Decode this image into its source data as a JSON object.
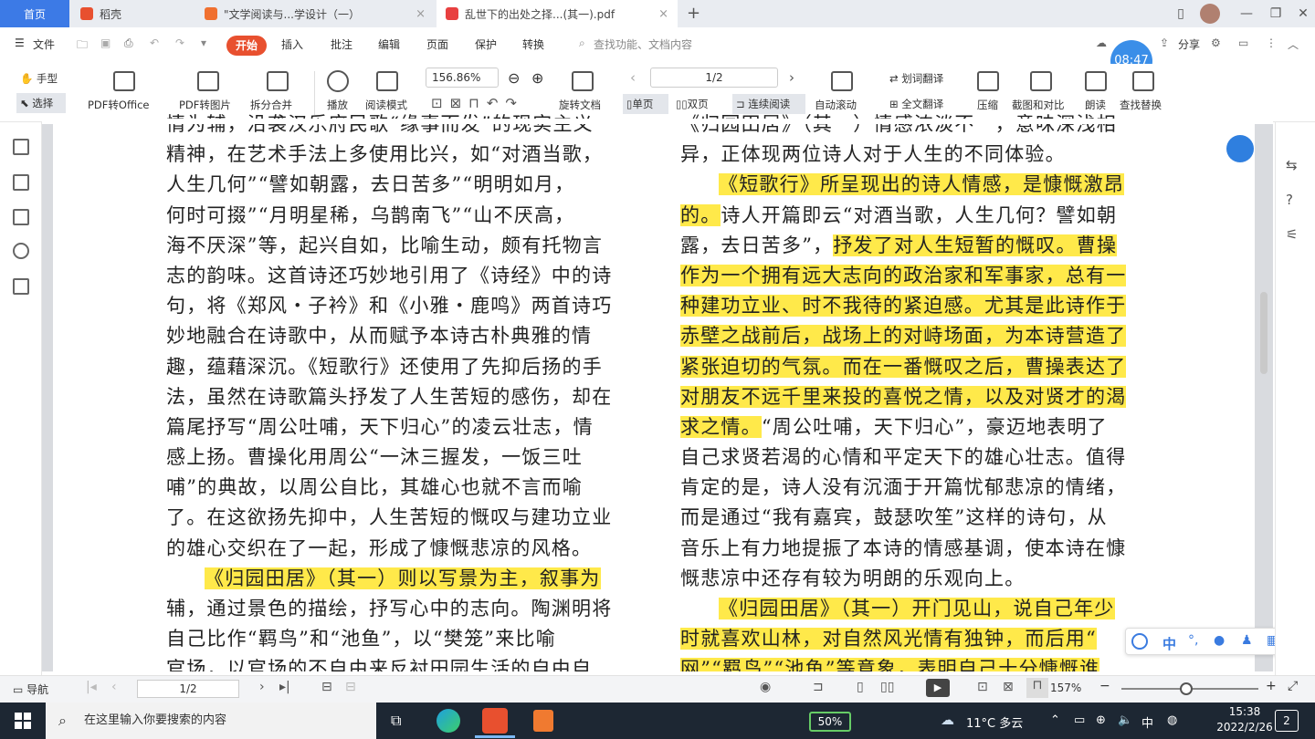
{
  "tabs": {
    "home": "首页",
    "t1": "稻壳",
    "t2": "\"文学阅读与...学设计（一）",
    "t3": "乱世下的出处之择...(其一).pdf",
    "add": "+"
  },
  "menu": {
    "file": "文件",
    "start": "开始",
    "insert": "插入",
    "annotate": "批注",
    "edit": "编辑",
    "page": "页面",
    "protect": "保护",
    "convert": "转换",
    "search_placeholder": "查找功能、文档内容",
    "share": "分享"
  },
  "toolbar": {
    "hand": "手型",
    "select": "选择",
    "pdf_to_office": "PDF转Office",
    "pdf_to_image": "PDF转图片",
    "split_merge": "拆分合并",
    "play": "播放",
    "reading_mode": "阅读模式",
    "zoom": "156.86%",
    "rotate_doc": "旋转文档",
    "page": "1/2",
    "single": "单页",
    "double": "双页",
    "continuous": "连续阅读",
    "auto_scroll": "自动滚动",
    "translate": "划词翻译",
    "full_translate": "全文翻译",
    "compress": "压缩",
    "screenshot_compare": "截图和对比",
    "read_aloud": "朗读",
    "find_replace": "查找替换"
  },
  "clock": "08:47",
  "doc": {
    "left_lines": [
      {
        "t": "情为辅，沿袭汉乐府民歌“缘事而发”的现实主义",
        "hl": false,
        "indent": false
      },
      {
        "t": "精神，在艺术手法上多使用比兴，如“对酒当歌，",
        "hl": false,
        "indent": false
      },
      {
        "t": "人生几何”“譬如朝露，去日苦多”“明明如月，",
        "hl": false,
        "indent": false
      },
      {
        "t": "何时可掇”“月明星稀，乌鹊南飞”“山不厌高，",
        "hl": false,
        "indent": false
      },
      {
        "t": "海不厌深”等，起兴自如，比喻生动，颇有托物言",
        "hl": false,
        "indent": false
      },
      {
        "t": "志的韵味。这首诗还巧妙地引用了《诗经》中的诗",
        "hl": false,
        "indent": false
      },
      {
        "t": "句，将《郑风・子衿》和《小雅・鹿鸣》两首诗巧",
        "hl": false,
        "indent": false
      },
      {
        "t": "妙地融合在诗歌中，从而赋予本诗古朴典雅的情",
        "hl": false,
        "indent": false
      },
      {
        "t": "趣，蕴藉深沉。《短歌行》还使用了先抑后扬的手",
        "hl": false,
        "indent": false
      },
      {
        "t": "法，虽然在诗歌篇头抒发了人生苦短的感伤，却在",
        "hl": false,
        "indent": false
      },
      {
        "t": "篇尾抒写“周公吐哺，天下归心”的凌云壮志，情",
        "hl": false,
        "indent": false
      },
      {
        "t": "感上扬。曹操化用周公“一沐三握发，一饭三吐",
        "hl": false,
        "indent": false
      },
      {
        "t": "哺”的典故，以周公自比，其雄心也就不言而喻",
        "hl": false,
        "indent": false
      },
      {
        "t": "了。在这欲扬先抑中，人生苦短的慨叹与建功立业",
        "hl": false,
        "indent": false
      },
      {
        "t": "的雄心交织在了一起，形成了慷慨悲凉的风格。",
        "hl": false,
        "indent": false
      },
      {
        "t": "《归园田居》（其一）则以写景为主，叙事为",
        "hl": true,
        "indent": true
      },
      {
        "t": "辅，通过景色的描绘，抒写心中的志向。陶渊明将",
        "hl": false,
        "indent": false
      },
      {
        "t": "自己比作“羁鸟”和“池鱼”，以“樊笼”来比喻",
        "hl": false,
        "indent": false
      },
      {
        "t": "官场，以官场的不自由来反衬田园生活的自由自",
        "hl": false,
        "indent": false
      }
    ],
    "right_lines": [
      {
        "parts": [
          {
            "t": "《归园田居》（其一）情感浓淡不一，意味深浅相",
            "hl": false
          }
        ],
        "indent": false
      },
      {
        "parts": [
          {
            "t": "异，正体现两位诗人对于人生的不同体验。",
            "hl": false
          }
        ],
        "indent": false
      },
      {
        "parts": [
          {
            "t": "《短歌行》所呈现出的诗人情感，是慷慨激昂",
            "hl": true
          }
        ],
        "indent": true
      },
      {
        "parts": [
          {
            "t": "的。",
            "hl": true
          },
          {
            "t": "诗人开篇即云“对酒当歌，人生几何？譬如朝",
            "hl": false
          }
        ],
        "indent": false
      },
      {
        "parts": [
          {
            "t": "露，去日苦多”，",
            "hl": false
          },
          {
            "t": "抒发了对人生短暂的慨叹。曹操",
            "hl": true
          }
        ],
        "indent": false
      },
      {
        "parts": [
          {
            "t": "作为一个拥有远大志向的政治家和军事家，总有一",
            "hl": true
          }
        ],
        "indent": false
      },
      {
        "parts": [
          {
            "t": "种建功立业、时不我待的紧迫感。尤其是此诗作于",
            "hl": true
          }
        ],
        "indent": false
      },
      {
        "parts": [
          {
            "t": "赤壁之战前后，战场上的对峙场面，为本诗营造了",
            "hl": true
          }
        ],
        "indent": false
      },
      {
        "parts": [
          {
            "t": "紧张迫切的气氛。而在一番慨叹之后，曹操表达了",
            "hl": true
          }
        ],
        "indent": false
      },
      {
        "parts": [
          {
            "t": "对朋友不远千里来投的喜悦之情，以及对贤才的渴",
            "hl": true
          }
        ],
        "indent": false
      },
      {
        "parts": [
          {
            "t": "求之情。",
            "hl": true
          },
          {
            "t": "“周公吐哺，天下归心”，豪迈地表明了",
            "hl": false
          }
        ],
        "indent": false
      },
      {
        "parts": [
          {
            "t": "自己求贤若渴的心情和平定天下的雄心壮志。值得",
            "hl": false
          }
        ],
        "indent": false
      },
      {
        "parts": [
          {
            "t": "肯定的是，诗人没有沉湎于开篇忧郁悲凉的情绪，",
            "hl": false
          }
        ],
        "indent": false
      },
      {
        "parts": [
          {
            "t": "而是通过“我有嘉宾，鼓瑟吹笙”这样的诗句，从",
            "hl": false
          }
        ],
        "indent": false
      },
      {
        "parts": [
          {
            "t": "音乐上有力地提振了本诗的情感基调，使本诗在慷",
            "hl": false
          }
        ],
        "indent": false
      },
      {
        "parts": [
          {
            "t": "慨悲凉中还存有较为明朗的乐观向上。",
            "hl": false
          }
        ],
        "indent": false
      },
      {
        "parts": [
          {
            "t": "《归园田居》（其一）开门见山，说自己年少",
            "hl": true
          }
        ],
        "indent": true
      },
      {
        "parts": [
          {
            "t": "时就喜欢山林，对自然风光情有独钟，而后用“",
            "hl": true
          }
        ],
        "indent": false
      },
      {
        "parts": [
          {
            "t": "网”“羁鸟”“池鱼”等意象，表明自己十分慷慨谁",
            "hl": true
          }
        ],
        "indent": false
      }
    ]
  },
  "float_toolbar": {
    "cn": "中"
  },
  "statusbar": {
    "nav": "导航",
    "page": "1/2",
    "zoom": "157%",
    "zoom_level": 0.47
  },
  "taskbar": {
    "search_placeholder": "在这里输入你要搜索的内容",
    "battery": "50%",
    "weather": "11°C 多云",
    "ime": "中",
    "time": "15:38",
    "date": "2022/2/26",
    "notifications": "2"
  },
  "colors": {
    "accent": "#3c7ae6",
    "start": "#e8502f",
    "highlight": "#ffe94a"
  }
}
